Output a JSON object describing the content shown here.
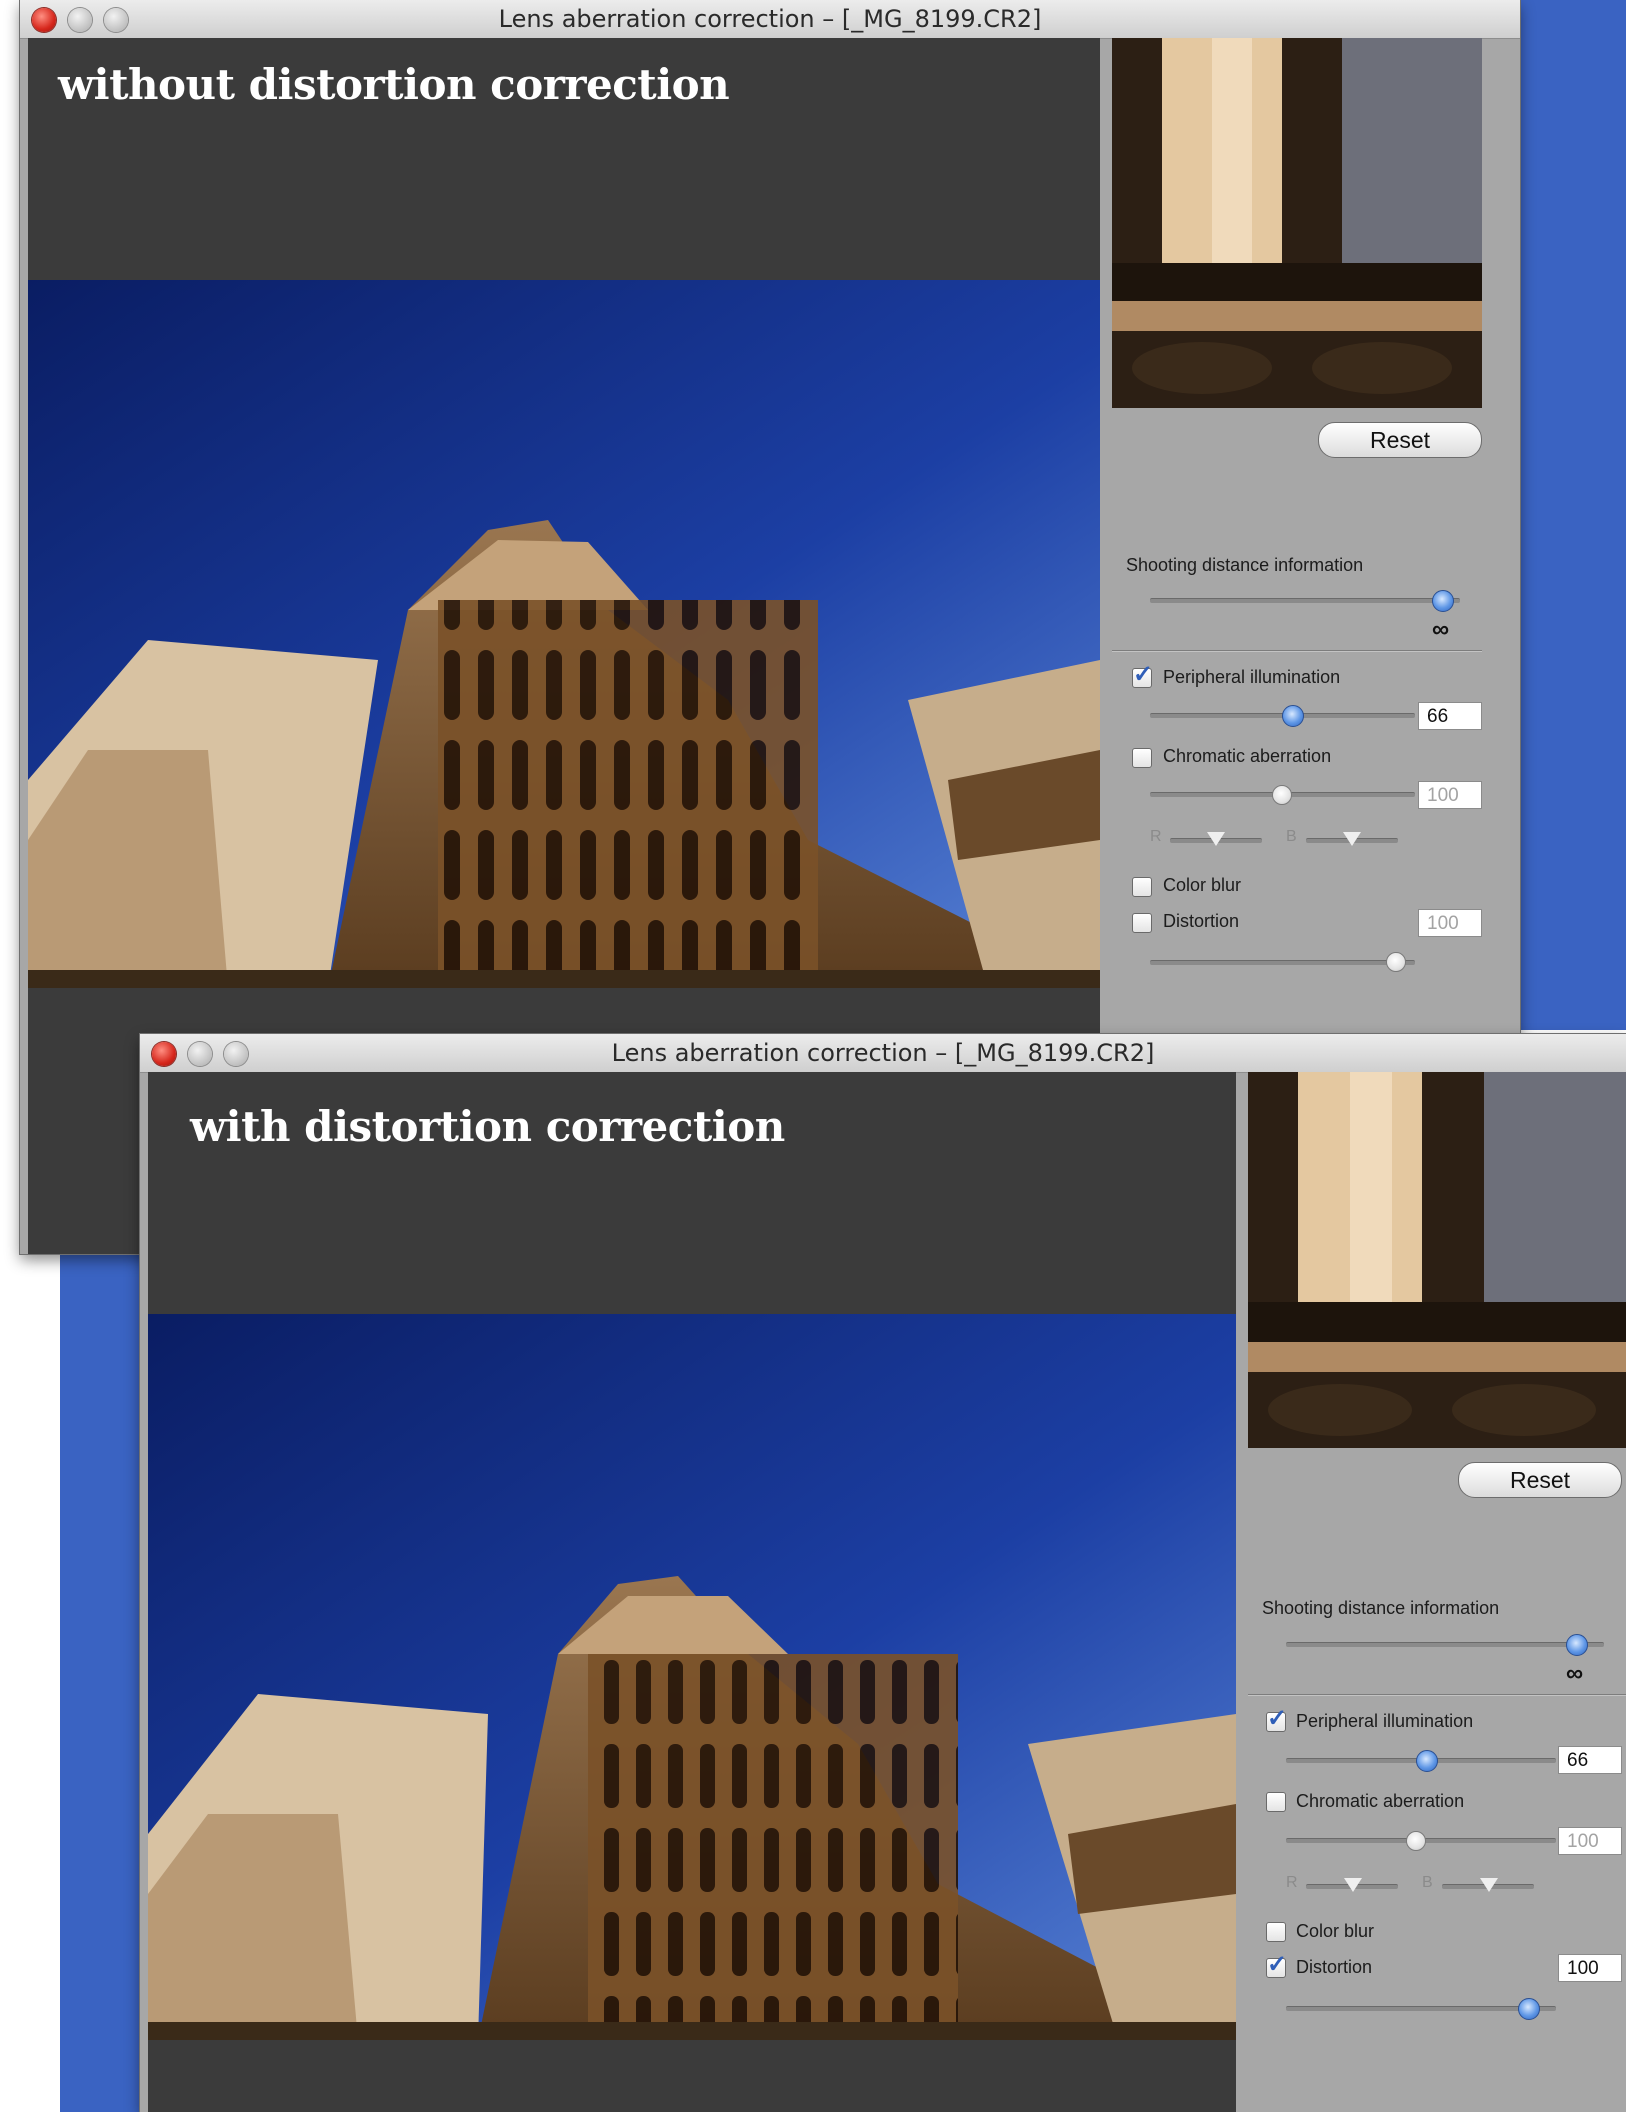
{
  "windows": [
    {
      "title": "Lens aberration correction – [_MG_8199.CR2]",
      "overlay_label": "without distortion correction",
      "reset_label": "Reset",
      "controls": {
        "shooting_distance_label": "Shooting distance information",
        "shooting_distance_value": "∞",
        "peripheral": {
          "label": "Peripheral illumination",
          "checked": true,
          "value": "66"
        },
        "chromatic": {
          "label": "Chromatic aberration",
          "checked": false,
          "value": "100",
          "r_label": "R",
          "b_label": "B"
        },
        "color_blur": {
          "label": "Color blur",
          "checked": false
        },
        "distortion": {
          "label": "Distortion",
          "checked": false,
          "value": "100"
        }
      }
    },
    {
      "title": "Lens aberration correction – [_MG_8199.CR2]",
      "overlay_label": "with distortion correction",
      "reset_label": "Reset",
      "controls": {
        "shooting_distance_label": "Shooting distance information",
        "shooting_distance_value": "∞",
        "peripheral": {
          "label": "Peripheral illumination",
          "checked": true,
          "value": "66"
        },
        "chromatic": {
          "label": "Chromatic aberration",
          "checked": false,
          "value": "100",
          "r_label": "R",
          "b_label": "B"
        },
        "color_blur": {
          "label": "Color blur",
          "checked": false
        },
        "distortion": {
          "label": "Distortion",
          "checked": true,
          "value": "100"
        }
      }
    }
  ],
  "icons": [
    "close-icon",
    "minimize-icon",
    "zoom-icon",
    "checkmark-icon",
    "infinity-icon"
  ],
  "colors": {
    "desktop_blue": "#3a63c2",
    "panel_gray": "#a7a7a7",
    "preview_dark": "#3b3b3b",
    "sky_blue": "#1e3d9c"
  }
}
